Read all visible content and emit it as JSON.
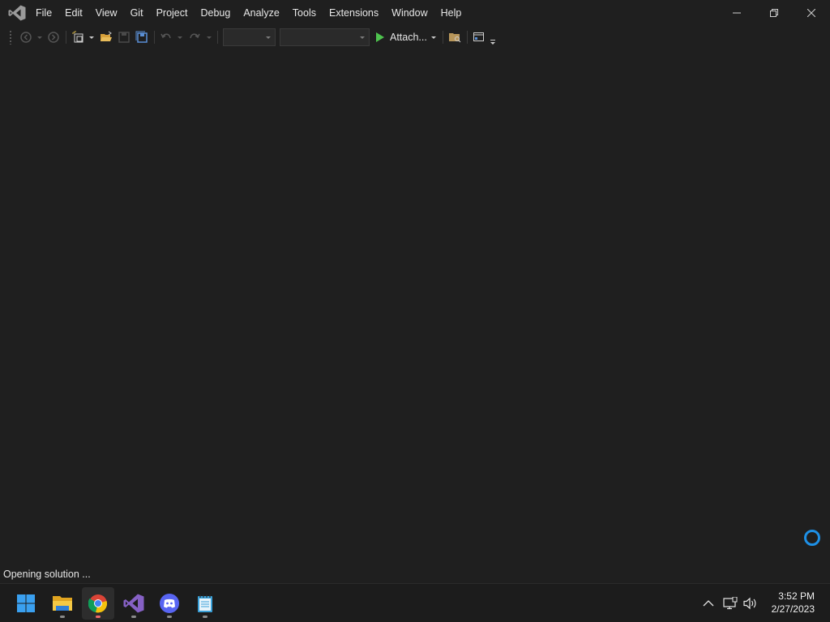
{
  "window": {
    "menu": [
      {
        "id": "file",
        "label": "File"
      },
      {
        "id": "edit",
        "label": "Edit"
      },
      {
        "id": "view",
        "label": "View"
      },
      {
        "id": "git",
        "label": "Git"
      },
      {
        "id": "project",
        "label": "Project"
      },
      {
        "id": "debug",
        "label": "Debug"
      },
      {
        "id": "analyze",
        "label": "Analyze"
      },
      {
        "id": "tools",
        "label": "Tools"
      },
      {
        "id": "extensions",
        "label": "Extensions"
      },
      {
        "id": "window",
        "label": "Window"
      },
      {
        "id": "help",
        "label": "Help"
      }
    ],
    "controls": [
      "minimize-icon",
      "restore-icon",
      "close-icon"
    ]
  },
  "toolbar": {
    "attach_label": "Attach...",
    "solution_config_value": "",
    "solution_platform_value": "",
    "icons": [
      "back-icon",
      "forward-icon",
      "new-project-icon",
      "open-folder-icon",
      "save-icon",
      "save-all-icon",
      "undo-icon",
      "redo-icon",
      "start-icon",
      "solution-explorer-icon",
      "window-layout-icon"
    ]
  },
  "status": {
    "text": "Opening solution ..."
  },
  "taskbar": {
    "apps": [
      {
        "id": "start",
        "icon": "windows-start-icon"
      },
      {
        "id": "explorer",
        "icon": "file-explorer-icon"
      },
      {
        "id": "chrome",
        "icon": "chrome-icon",
        "active": true
      },
      {
        "id": "visualstudio",
        "icon": "visual-studio-icon"
      },
      {
        "id": "discord",
        "icon": "discord-icon"
      },
      {
        "id": "notepad",
        "icon": "notepad-icon"
      }
    ],
    "tray": [
      "chevron-up-icon",
      "network-icon",
      "volume-icon"
    ],
    "clock": {
      "time": "3:52 PM",
      "date": "2/27/2023"
    }
  },
  "colors": {
    "background": "#1f1f1f",
    "accent_blue": "#1e90e6",
    "vs_purple": "#8661c5",
    "run_green": "#4ec34e"
  }
}
